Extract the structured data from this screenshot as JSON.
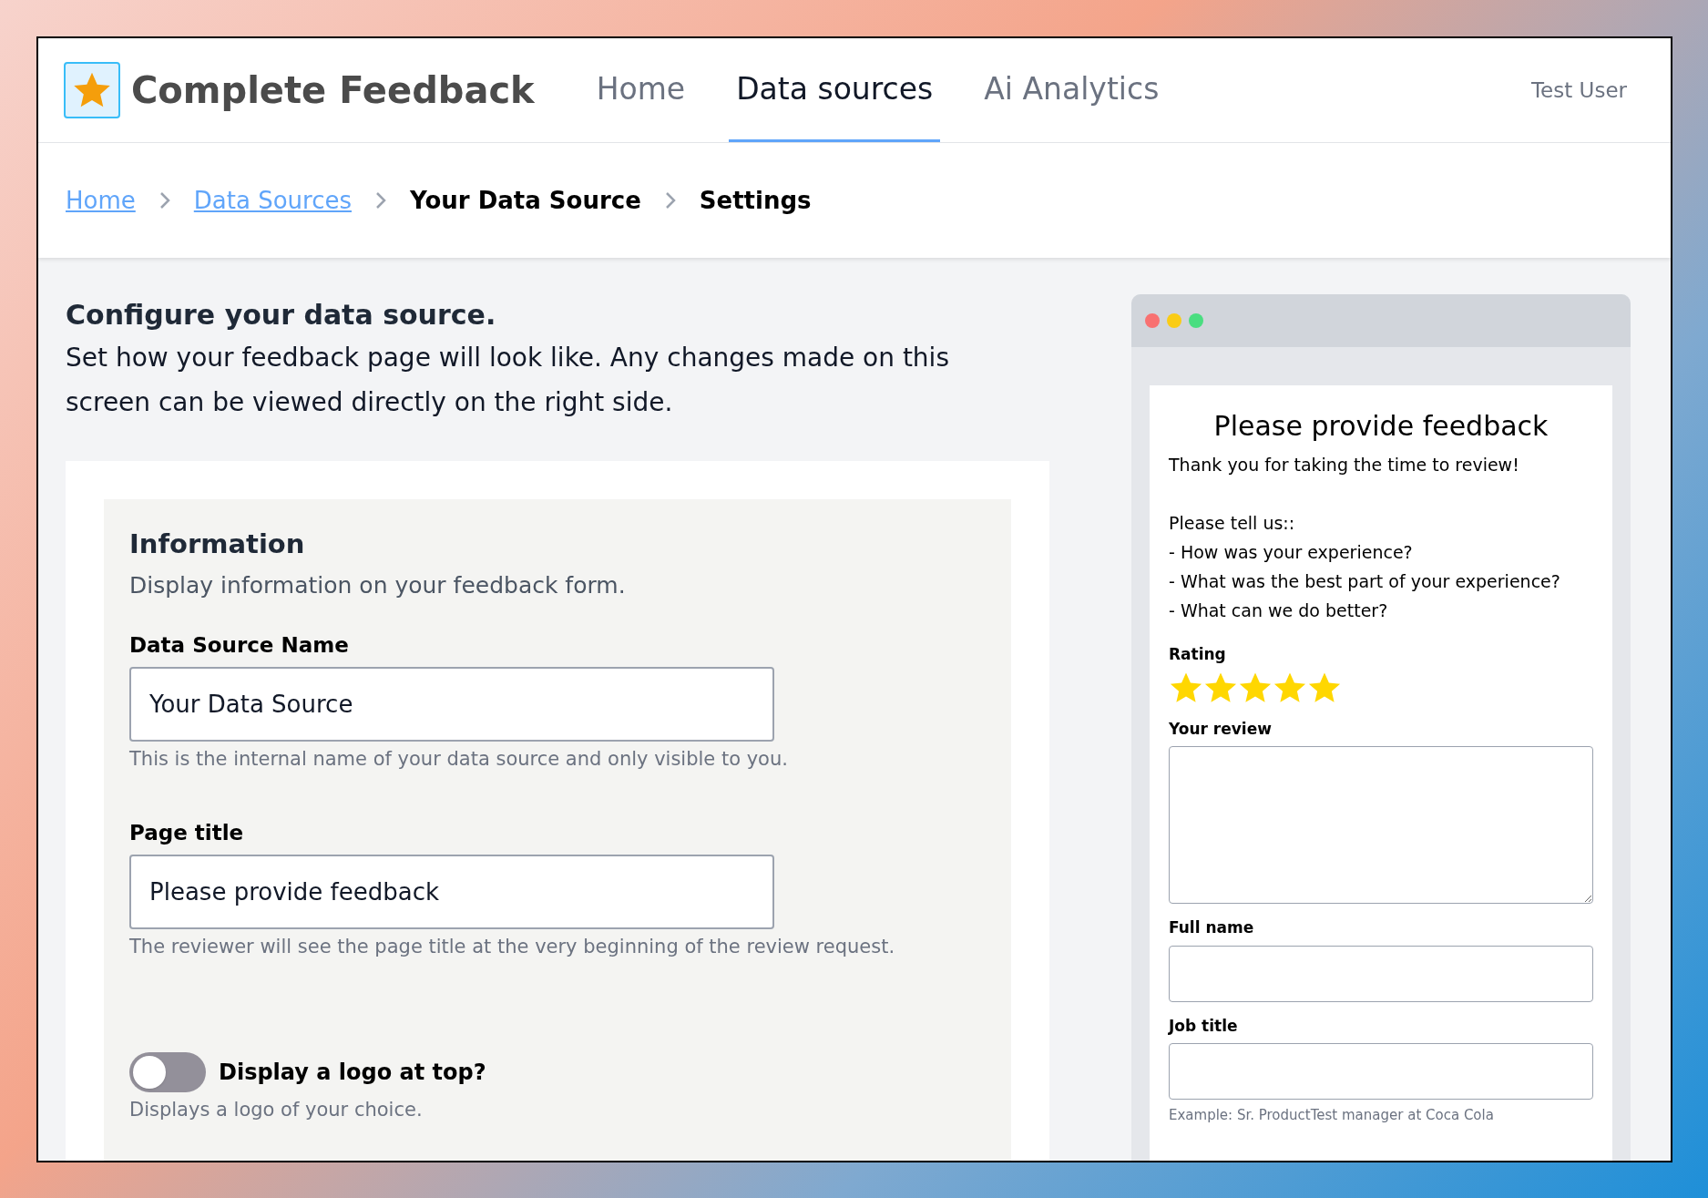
{
  "header": {
    "brand": "Complete Feedback",
    "nav": [
      {
        "label": "Home",
        "selected": false
      },
      {
        "label": "Data sources",
        "selected": true
      },
      {
        "label": "Ai Analytics",
        "selected": false
      }
    ],
    "user": "Test User"
  },
  "breadcrumb": [
    {
      "label": "Home",
      "kind": "link"
    },
    {
      "label": "Data Sources",
      "kind": "link"
    },
    {
      "label": "Your Data Source",
      "kind": "current"
    },
    {
      "label": "Settings",
      "kind": "current"
    }
  ],
  "intro": {
    "title": "Configure your data source.",
    "text": "Set how your feedback page will look like. Any changes made on this screen can be viewed directly on the right side."
  },
  "information": {
    "title": "Information",
    "subtitle": "Display information on your feedback form.",
    "fields": [
      {
        "label": "Data Source Name",
        "value": "Your Data Source",
        "help": "This is the internal name of your data source and only visible to you."
      },
      {
        "label": "Page title",
        "value": "Please provide feedback",
        "help": "The reviewer will see the page title at the very beginning of the review request."
      }
    ],
    "toggle": {
      "label": "Display a logo at top?",
      "help": "Displays a logo of your choice.",
      "on": false
    }
  },
  "preview": {
    "title": "Please provide feedback",
    "greeting": "Thank you for taking the time to review!",
    "lines": [
      "Please tell us::",
      "- How was your experience?",
      "- What was the best part of your experience?",
      "- What can we do better?"
    ],
    "rating": {
      "label": "Rating",
      "stars": 5
    },
    "fields": [
      {
        "label": "Your review",
        "kind": "textarea"
      },
      {
        "label": "Full name",
        "kind": "input"
      },
      {
        "label": "Job title",
        "kind": "input",
        "help": "Example: Sr. ProductTest manager at Coca Cola"
      }
    ]
  }
}
